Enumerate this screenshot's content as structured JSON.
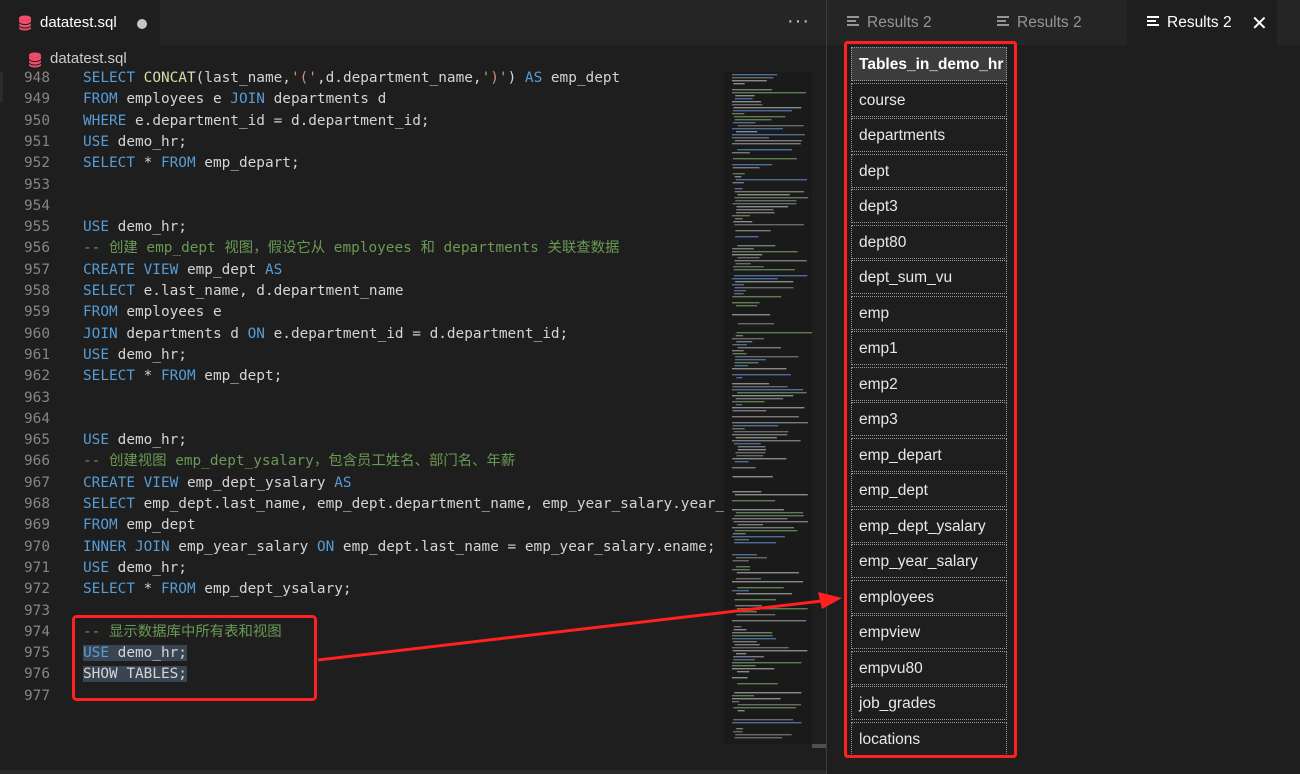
{
  "editor": {
    "tab_title": "datatest.sql",
    "breadcrumb": "datatest.sql",
    "more_glyph": "···",
    "lines": [
      {
        "n": "948",
        "tokens": [
          [
            "kw",
            "SELECT "
          ],
          [
            "fn",
            "CONCAT"
          ],
          [
            "p",
            "(last_name,"
          ],
          [
            "st",
            "'('"
          ],
          [
            "p",
            ",d.department_name,"
          ],
          [
            "st",
            "')'"
          ],
          [
            "p",
            ") "
          ],
          [
            "kw",
            "AS"
          ],
          [
            "p",
            " emp_dept"
          ]
        ]
      },
      {
        "n": "949",
        "tokens": [
          [
            "kw",
            "FROM"
          ],
          [
            "p",
            " employees e "
          ],
          [
            "kw",
            "JOIN"
          ],
          [
            "p",
            " departments d"
          ]
        ]
      },
      {
        "n": "950",
        "tokens": [
          [
            "kw",
            "WHERE"
          ],
          [
            "p",
            " e.department_id = d.department_id;"
          ]
        ]
      },
      {
        "n": "951",
        "tokens": [
          [
            "kw",
            "USE"
          ],
          [
            "p",
            " demo_hr;"
          ]
        ]
      },
      {
        "n": "952",
        "tokens": [
          [
            "kw",
            "SELECT"
          ],
          [
            "p",
            " * "
          ],
          [
            "kw",
            "FROM"
          ],
          [
            "p",
            " emp_depart;"
          ]
        ]
      },
      {
        "n": "953",
        "tokens": []
      },
      {
        "n": "954",
        "tokens": []
      },
      {
        "n": "955",
        "tokens": [
          [
            "kw",
            "USE"
          ],
          [
            "p",
            " demo_hr;"
          ]
        ]
      },
      {
        "n": "956",
        "tokens": [
          [
            "cm",
            "-- 创建 emp_dept 视图，假设它从 employees 和 departments 关联查数据"
          ]
        ]
      },
      {
        "n": "957",
        "tokens": [
          [
            "kw",
            "CREATE VIEW"
          ],
          [
            "p",
            " emp_dept "
          ],
          [
            "kw",
            "AS"
          ]
        ]
      },
      {
        "n": "958",
        "tokens": [
          [
            "kw",
            "SELECT"
          ],
          [
            "p",
            " e.last_name, d.department_name"
          ]
        ]
      },
      {
        "n": "959",
        "tokens": [
          [
            "kw",
            "FROM"
          ],
          [
            "p",
            " employees e"
          ]
        ]
      },
      {
        "n": "960",
        "tokens": [
          [
            "kw",
            "JOIN"
          ],
          [
            "p",
            " departments d "
          ],
          [
            "kw",
            "ON"
          ],
          [
            "p",
            " e.department_id = d.department_id;"
          ]
        ]
      },
      {
        "n": "961",
        "tokens": [
          [
            "kw",
            "USE"
          ],
          [
            "p",
            " demo_hr;"
          ]
        ]
      },
      {
        "n": "962",
        "tokens": [
          [
            "kw",
            "SELECT"
          ],
          [
            "p",
            " * "
          ],
          [
            "kw",
            "FROM"
          ],
          [
            "p",
            " emp_dept;"
          ]
        ]
      },
      {
        "n": "963",
        "tokens": []
      },
      {
        "n": "964",
        "tokens": []
      },
      {
        "n": "965",
        "tokens": [
          [
            "kw",
            "USE"
          ],
          [
            "p",
            " demo_hr;"
          ]
        ]
      },
      {
        "n": "966",
        "tokens": [
          [
            "cm",
            "-- 创建视图 emp_dept_ysalary，包含员工姓名、部门名、年薪"
          ]
        ]
      },
      {
        "n": "967",
        "tokens": [
          [
            "kw",
            "CREATE VIEW"
          ],
          [
            "p",
            " emp_dept_ysalary "
          ],
          [
            "kw",
            "AS"
          ]
        ]
      },
      {
        "n": "968",
        "tokens": [
          [
            "kw",
            "SELECT"
          ],
          [
            "p",
            " emp_dept.last_name, emp_dept.department_name, emp_year_salary.year_"
          ]
        ]
      },
      {
        "n": "969",
        "tokens": [
          [
            "kw",
            "FROM"
          ],
          [
            "p",
            " emp_dept"
          ]
        ]
      },
      {
        "n": "970",
        "tokens": [
          [
            "kw",
            "INNER JOIN"
          ],
          [
            "p",
            " emp_year_salary "
          ],
          [
            "kw",
            "ON"
          ],
          [
            "p",
            " emp_dept.last_name = emp_year_salary.ename;"
          ]
        ]
      },
      {
        "n": "971",
        "tokens": [
          [
            "kw",
            "USE"
          ],
          [
            "p",
            " demo_hr;"
          ]
        ]
      },
      {
        "n": "972",
        "tokens": [
          [
            "kw",
            "SELECT"
          ],
          [
            "p",
            " * "
          ],
          [
            "kw",
            "FROM"
          ],
          [
            "p",
            " emp_dept_ysalary;"
          ]
        ]
      },
      {
        "n": "973",
        "tokens": []
      },
      {
        "n": "974",
        "tokens": [
          [
            "cm",
            "-- 显示数据库中所有表和视图"
          ]
        ]
      },
      {
        "n": "975",
        "tokens": [
          [
            "kwsel",
            "USE"
          ],
          [
            "sel",
            " demo_hr;"
          ]
        ]
      },
      {
        "n": "976",
        "tokens": [
          [
            "sel",
            "SHOW TABLES;"
          ]
        ]
      },
      {
        "n": "977",
        "tokens": []
      }
    ]
  },
  "results": {
    "tabs": [
      {
        "label": "Results 2"
      },
      {
        "label": "Results 2"
      },
      {
        "label": "Results 2",
        "close": "✕"
      }
    ],
    "column_header": "Tables_in_demo_hr",
    "rows": [
      "course",
      "departments",
      "dept",
      "dept3",
      "dept80",
      "dept_sum_vu",
      "emp",
      "emp1",
      "emp2",
      "emp3",
      "emp_depart",
      "emp_dept",
      "emp_dept_ysalary",
      "emp_year_salary",
      "employees",
      "empview",
      "empvu80",
      "job_grades",
      "locations"
    ]
  },
  "colors": {
    "background": "#1e1e1e",
    "keyword": "#569cd6",
    "comment": "#6a9955",
    "string": "#ce9178",
    "annotation_red": "#ff2020",
    "db_icon": "#f14c6c"
  }
}
